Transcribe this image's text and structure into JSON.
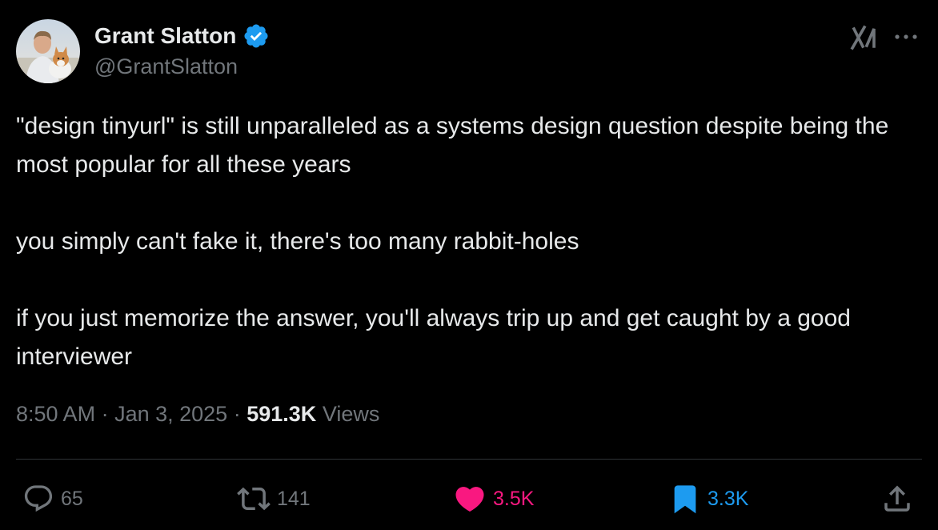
{
  "author": {
    "name": "Grant Slatton",
    "handle": "@GrantSlatton",
    "verified": true
  },
  "tweet": {
    "paragraphs": [
      "\"design tinyurl\" is still unparalleled as a systems design question despite being the most popular for all these years",
      "you simply can't fake it, there's too many rabbit-holes",
      "if you just memorize the answer, you'll always trip up and get caught by a good interviewer"
    ],
    "time": "8:50 AM",
    "date": "Jan 3, 2025",
    "views_count": "591.3K",
    "views_label": "Views"
  },
  "actions": {
    "reply_count": "65",
    "repost_count": "141",
    "like_count": "3.5K",
    "bookmark_count": "3.3K"
  },
  "icons": {
    "verified": "verified-badge-icon",
    "grok": "grok-icon",
    "more": "more-icon",
    "reply": "reply-icon",
    "repost": "repost-icon",
    "like": "heart-icon",
    "bookmark": "bookmark-icon",
    "share": "share-icon"
  },
  "colors": {
    "background": "#000000",
    "text_primary": "#e7e9ea",
    "text_secondary": "#71767b",
    "verified_blue": "#1d9bf0",
    "like_pink": "#f91880",
    "bookmark_blue": "#1d9bf0",
    "divider": "#2f3336"
  }
}
